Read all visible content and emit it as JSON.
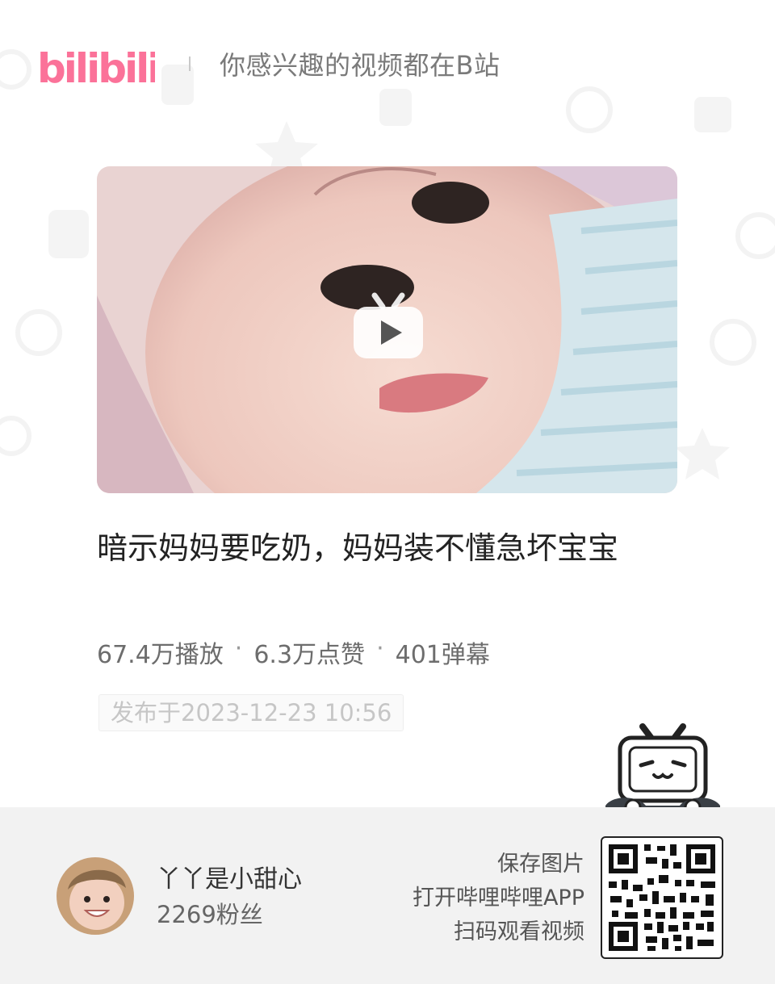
{
  "header": {
    "logo_text": "bilibili",
    "slogan": "你感兴趣的视频都在B站"
  },
  "video": {
    "title": "暗示妈妈要吃奶，妈妈装不懂急坏宝宝",
    "stats": {
      "views": "67.4万播放",
      "likes": "6.3万点赞",
      "danmaku": "401弹幕",
      "separator": "·"
    },
    "publish_time": "发布于2023-12-23 10:56"
  },
  "author": {
    "name": "丫丫是小甜心",
    "fans": "2269粉丝"
  },
  "qr": {
    "line1": "保存图片",
    "line2": "打开哔哩哔哩APP",
    "line3": "扫码观看视频"
  },
  "colors": {
    "brand_pink": "#fb7299",
    "footer_bg": "#f2f2f2"
  },
  "icons": [
    "play-icon",
    "bilibili-tv-mascot-icon",
    "qr-code"
  ]
}
